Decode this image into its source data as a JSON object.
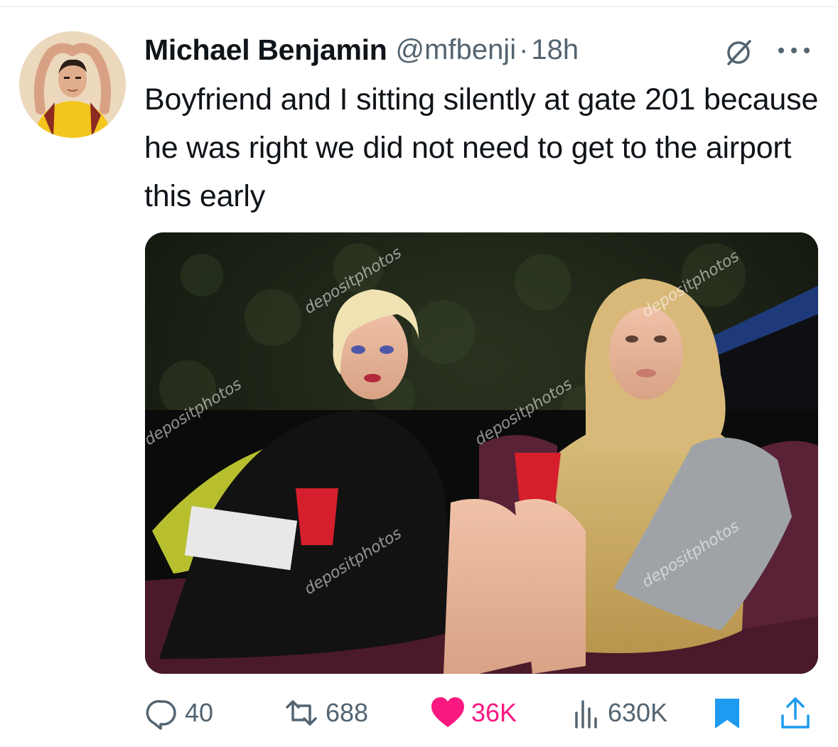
{
  "tweet": {
    "author": {
      "display_name": "Michael Benjamin",
      "handle": "@mfbenji",
      "separator": "·",
      "time": "18h"
    },
    "text": "Boyfriend and I sitting silently at gate 201 because he was right we did not need to get to the airport this early",
    "media": {
      "watermark": "depositphotos"
    }
  },
  "actions": {
    "reply": {
      "count": "40",
      "icon": "reply-icon"
    },
    "retweet": {
      "count": "688",
      "icon": "retweet-icon"
    },
    "like": {
      "count": "36K",
      "icon": "heart-icon",
      "color": "#f91880"
    },
    "views": {
      "count": "630K",
      "icon": "views-icon"
    },
    "bookmark": {
      "icon": "bookmark-icon",
      "color": "#1d9bf0"
    },
    "share": {
      "icon": "share-icon",
      "color": "#1d9bf0"
    }
  },
  "colors": {
    "text_primary": "#0f1419",
    "text_secondary": "#536471",
    "accent_blue": "#1d9bf0"
  }
}
